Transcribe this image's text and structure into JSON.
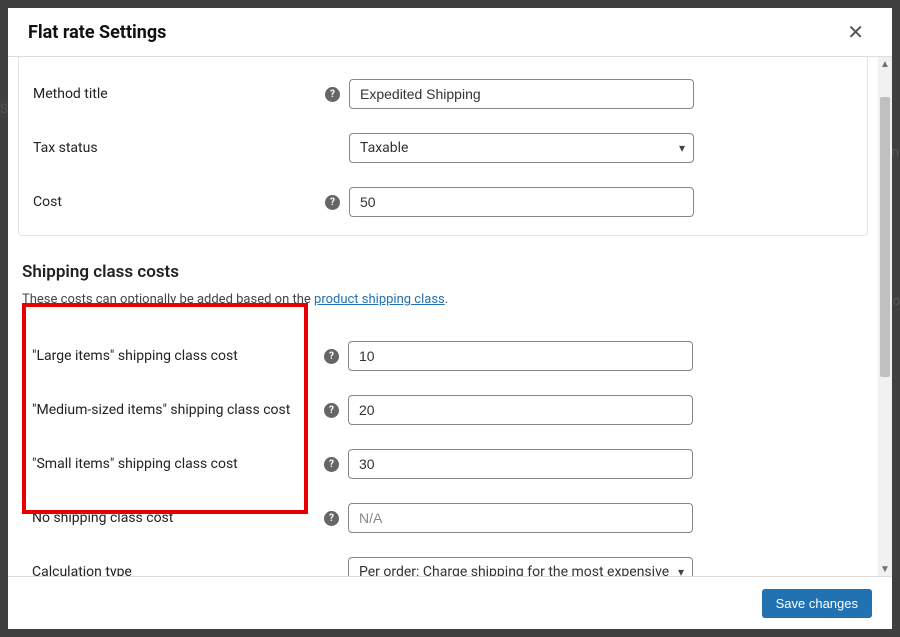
{
  "modal": {
    "title": "Flat rate Settings"
  },
  "fields": {
    "method_title": {
      "label": "Method title",
      "value": "Expedited Shipping"
    },
    "tax_status": {
      "label": "Tax status",
      "selected": "Taxable"
    },
    "cost": {
      "label": "Cost",
      "value": "50"
    }
  },
  "section": {
    "heading": "Shipping class costs",
    "description_pre": "These costs can optionally be added based on the ",
    "description_link": "product shipping class",
    "description_post": "."
  },
  "class_costs": {
    "large": {
      "label": "\"Large items\" shipping class cost",
      "value": "10"
    },
    "medium": {
      "label": "\"Medium-sized items\" shipping class cost",
      "value": "20"
    },
    "small": {
      "label": "\"Small items\" shipping class cost",
      "value": "30"
    },
    "none": {
      "label": "No shipping class cost",
      "placeholder": "N/A"
    },
    "calc": {
      "label": "Calculation type",
      "selected": "Per order: Charge shipping for the most expensive shipping class"
    }
  },
  "footer": {
    "save_label": "Save changes"
  },
  "background": {
    "left1": "S",
    "right1": "m",
    "right2": "to"
  }
}
